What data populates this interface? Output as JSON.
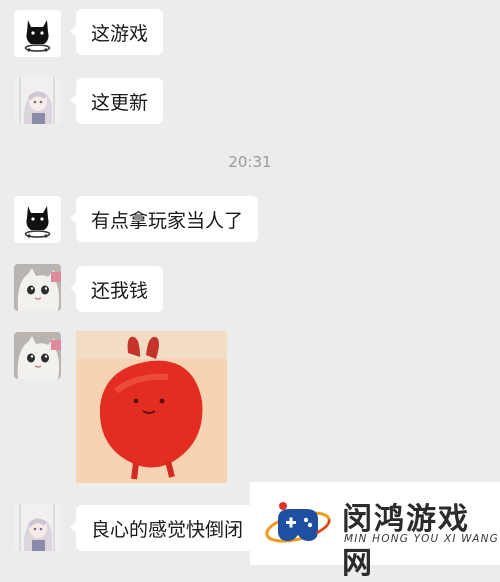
{
  "chat": {
    "messages": [
      {
        "text": "这游戏",
        "avatar": "black-cat-avatar"
      },
      {
        "text": "这更新",
        "avatar": "anime-girl-avatar"
      },
      {
        "text": "有点拿玩家当人了",
        "avatar": "black-cat-avatar"
      },
      {
        "text": "还我钱",
        "avatar": "white-cat-avatar"
      },
      {
        "sticker": "red-rabbit-sticker",
        "avatar": "white-cat-avatar"
      },
      {
        "text": "良心的感觉快倒闭",
        "avatar": "anime-girl-avatar"
      }
    ],
    "timestamp": "20:31"
  },
  "watermark": {
    "title": "闵鸿游戏网",
    "subtitle": "MIN HONG YOU XI WANG",
    "logo_colors": {
      "blue": "#1f4fa0",
      "red": "#e0352b",
      "orange": "#f29a1c"
    }
  },
  "colors": {
    "background": "#ececec",
    "bubble": "#ffffff",
    "time": "#9a9a9a"
  }
}
